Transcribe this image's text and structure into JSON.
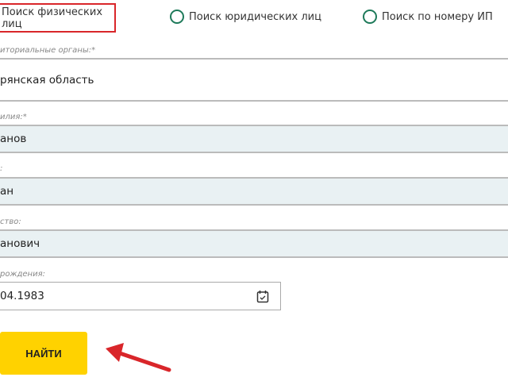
{
  "search_modes": [
    {
      "label": "Поиск физических лиц",
      "selected": true
    },
    {
      "label": "Поиск юридических лиц",
      "selected": false
    },
    {
      "label": "Поиск по номеру ИП",
      "selected": false
    }
  ],
  "fields": {
    "region": {
      "label": "иториальные органы:*",
      "value": "рянская область"
    },
    "surname": {
      "label": "илия:*",
      "value": "анов"
    },
    "name": {
      "label": ":",
      "value": "ан"
    },
    "patronymic": {
      "label": "ство:",
      "value": "анович"
    },
    "birthdate": {
      "label": "рождения:",
      "value": "04.1983"
    }
  },
  "submit_label": "НАЙТИ",
  "colors": {
    "highlight": "#d9262a",
    "radio": "#1e7a5a",
    "button": "#ffd200",
    "arrow": "#d9262a"
  }
}
